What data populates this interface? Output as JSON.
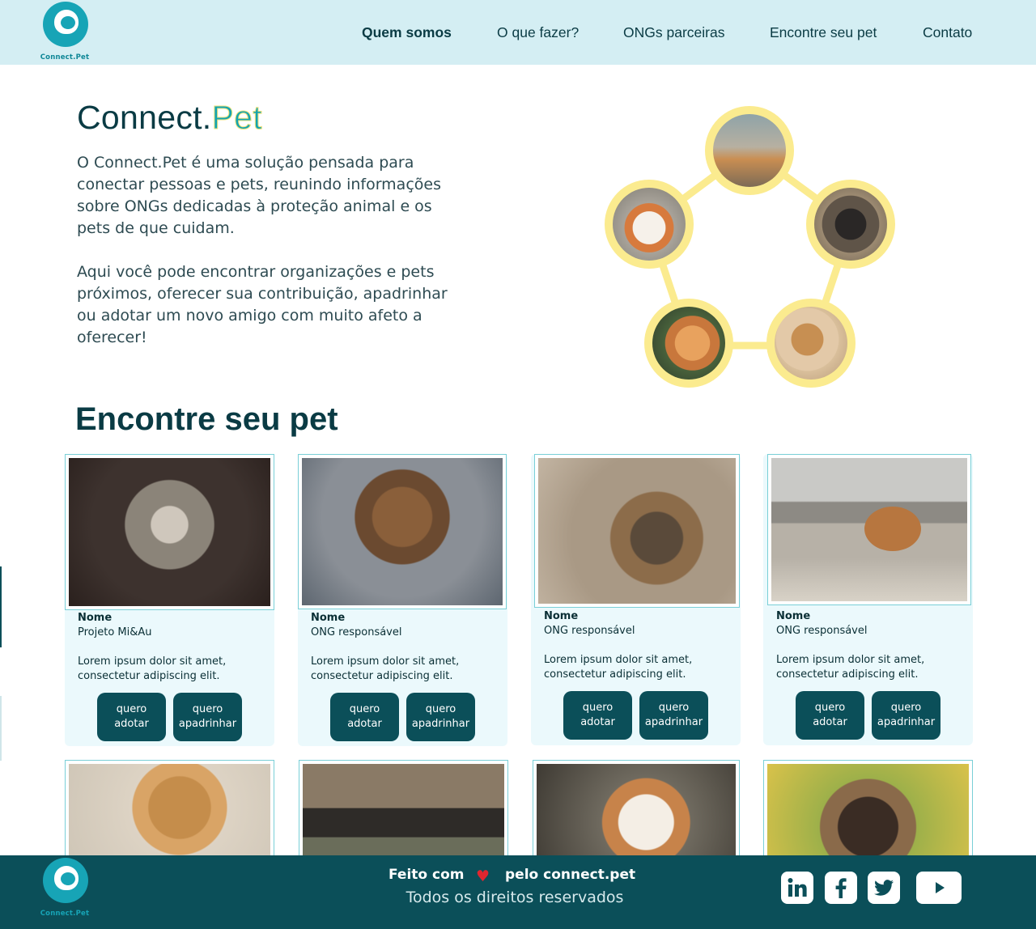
{
  "header": {
    "logo_text": "Connect.Pet",
    "nav": [
      {
        "label": "Quem somos",
        "active": true
      },
      {
        "label": "O que fazer?",
        "active": false
      },
      {
        "label": "ONGs parceiras",
        "active": false
      },
      {
        "label": "Encontre seu pet",
        "active": false
      },
      {
        "label": "Contato",
        "active": false
      }
    ]
  },
  "hero": {
    "title_part1": "Connect.",
    "title_part2": "Pet",
    "paragraph1": "O Connect.Pet é uma solução pensada para conectar pessoas e pets, reunindo informações sobre ONGs dedicadas à proteção animal e os pets de que cuidam.",
    "paragraph2": "Aqui você pode encontrar organizações e pets próximos, oferecer sua contribuição, apadrinhar ou adotar um novo amigo com muito afeto a oferecer!"
  },
  "find_pet": {
    "title": "Encontre seu pet",
    "cards": [
      {
        "name_label": "Nome",
        "org": "Projeto Mi&Au",
        "desc": "Lorem ipsum dolor sit amet, consectetur adipiscing elit.",
        "btn_adopt": "quero adotar",
        "btn_sponsor": "quero apadrinhar"
      },
      {
        "name_label": "Nome",
        "org": "ONG responsável",
        "desc": "Lorem ipsum dolor sit amet, consectetur adipiscing elit.",
        "btn_adopt": "quero adotar",
        "btn_sponsor": "quero apadrinhar"
      },
      {
        "name_label": "Nome",
        "org": "ONG responsável",
        "desc": "Lorem ipsum dolor sit amet, consectetur adipiscing elit.",
        "btn_adopt": "quero adotar",
        "btn_sponsor": "quero apadrinhar"
      },
      {
        "name_label": "Nome",
        "org": "ONG responsável",
        "desc": "Lorem ipsum dolor sit amet, consectetur adipiscing elit.",
        "btn_adopt": "quero adotar",
        "btn_sponsor": "quero apadrinhar"
      }
    ]
  },
  "footer": {
    "logo_text": "Connect.Pet",
    "made_with": "Feito com",
    "made_by": "pelo connect.pet",
    "rights": "Todos os direitos reservados",
    "social_icons": [
      "linkedin-icon",
      "facebook-icon",
      "twitter-icon",
      "youtube-icon"
    ]
  },
  "colors": {
    "header_bg": "#d4eef3",
    "primary_dark": "#0b4f59",
    "card_bg": "#ebf9fc",
    "accent_yellow": "#fbeb8f",
    "brand_teal": "#13a3b1"
  }
}
